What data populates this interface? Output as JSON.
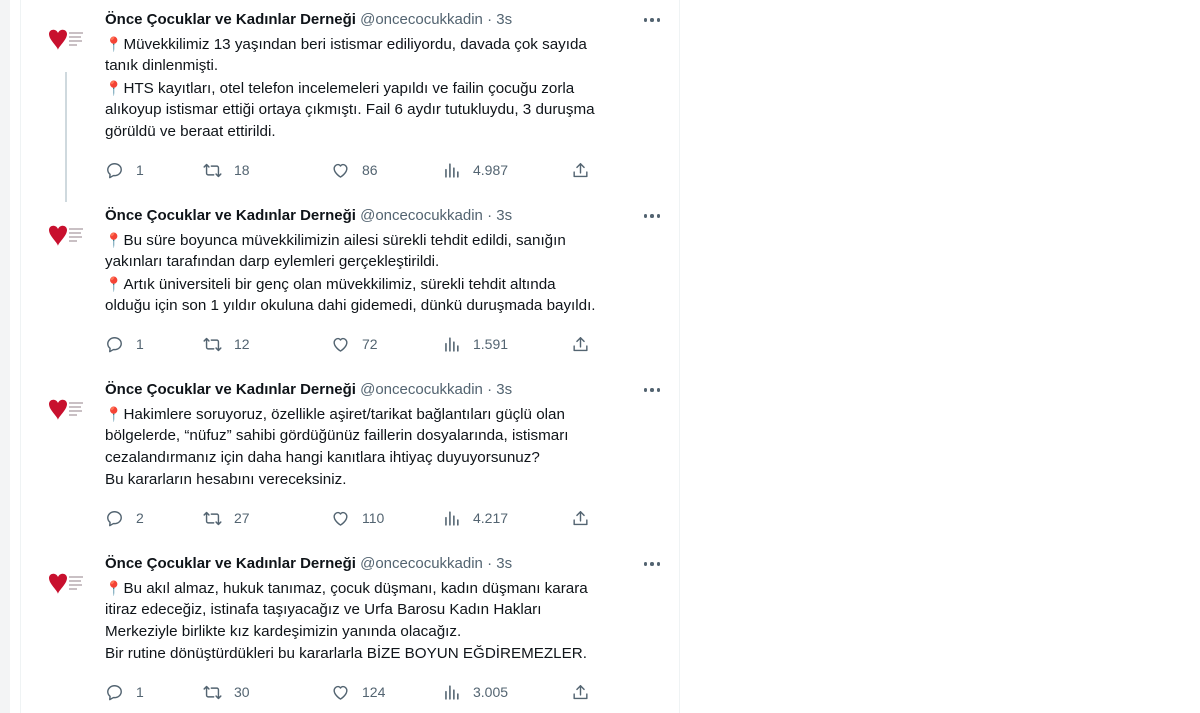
{
  "tweets": [
    {
      "name": "Önce Çocuklar ve Kadınlar Derneği",
      "handle": "@oncecocukkadin",
      "separator": "·",
      "time": "3s",
      "lines": [
        {
          "pin": true,
          "text": "Müvekkilimiz 13 yaşından beri istismar ediliyordu, davada çok sayıda"
        },
        {
          "pin": false,
          "text": "tanık dinlenmişti."
        },
        {
          "pin": true,
          "text": "HTS kayıtları, otel telefon incelemeleri yapıldı ve failin çocuğu zorla"
        },
        {
          "pin": false,
          "text": "alıkoyup istismar ettiği ortaya çıkmıştı. Fail 6 aydır tutukluydu, 3 duruşma"
        },
        {
          "pin": false,
          "text": "görüldü ve beraat ettirildi."
        }
      ],
      "replies": "1",
      "retweets": "18",
      "likes": "86",
      "views": "4.987"
    },
    {
      "name": "Önce Çocuklar ve Kadınlar Derneği",
      "handle": "@oncecocukkadin",
      "separator": "·",
      "time": "3s",
      "lines": [
        {
          "pin": true,
          "text": "Bu süre boyunca müvekkilimizin ailesi sürekli tehdit edildi, sanığın"
        },
        {
          "pin": false,
          "text": "yakınları tarafından darp eylemleri gerçekleştirildi."
        },
        {
          "pin": true,
          "text": "Artık üniversiteli bir genç olan müvekkilimiz, sürekli tehdit altında"
        },
        {
          "pin": false,
          "text": "olduğu için son 1 yıldır okuluna dahi gidemedi, dünkü duruşmada bayıldı."
        }
      ],
      "replies": "1",
      "retweets": "12",
      "likes": "72",
      "views": "1.591"
    },
    {
      "name": "Önce Çocuklar ve Kadınlar Derneği",
      "handle": "@oncecocukkadin",
      "separator": "·",
      "time": "3s",
      "lines": [
        {
          "pin": true,
          "text": "Hakimlere soruyoruz, özellikle aşiret/tarikat bağlantıları güçlü olan"
        },
        {
          "pin": false,
          "text": "bölgelerde, “nüfuz” sahibi gördüğünüz faillerin dosyalarında, istismarı"
        },
        {
          "pin": false,
          "text": "cezalandırmanız için daha hangi kanıtlara ihtiyaç duyuyorsunuz?"
        },
        {
          "pin": false,
          "text": "Bu kararların hesabını vereceksiniz."
        }
      ],
      "replies": "2",
      "retweets": "27",
      "likes": "110",
      "views": "4.217"
    },
    {
      "name": "Önce Çocuklar ve Kadınlar Derneği",
      "handle": "@oncecocukkadin",
      "separator": "·",
      "time": "3s",
      "lines": [
        {
          "pin": true,
          "text": "Bu akıl almaz, hukuk tanımaz, çocuk düşmanı, kadın düşmanı karara"
        },
        {
          "pin": false,
          "text": "itiraz edeceğiz, istinafa taşıyacağız ve Urfa Barosu Kadın Hakları"
        },
        {
          "pin": false,
          "text": "Merkeziyle birlikte kız kardeşimizin yanında olacağız."
        },
        {
          "pin": false,
          "text": "Bir rutine dönüştürdükleri bu kararlarla BİZE BOYUN EĞDİREMEZLER."
        }
      ],
      "replies": "1",
      "retweets": "30",
      "likes": "124",
      "views": "3.005"
    }
  ],
  "icons": {
    "pin": "📍",
    "reply": "reply-icon",
    "retweet": "retweet-icon",
    "like": "heart-icon",
    "views": "views-icon",
    "share": "share-icon",
    "more": "more-icon",
    "avatar": "organization-logo"
  },
  "colors": {
    "text": "#0f1419",
    "muted": "#536471",
    "avatar_heart": "#c8102e",
    "pin": "#e0245e"
  }
}
